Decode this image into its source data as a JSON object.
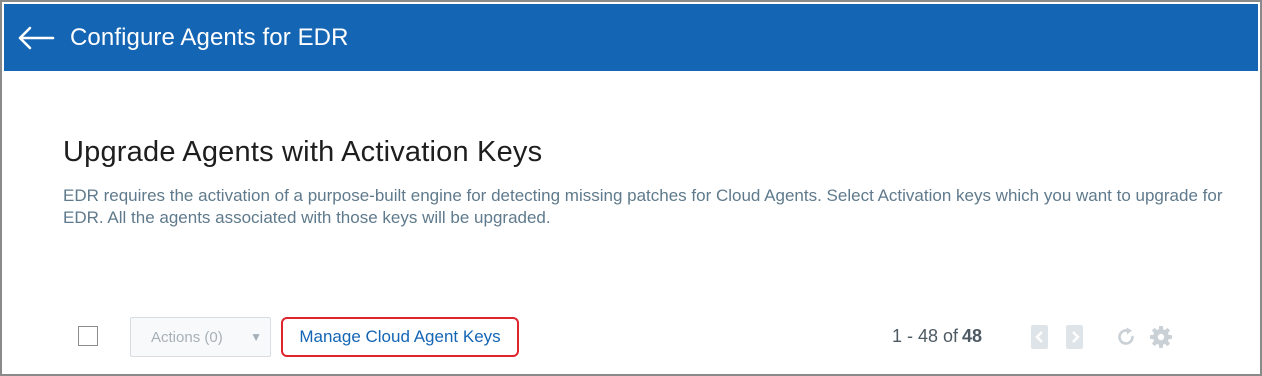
{
  "header": {
    "back_icon": "arrow-left-icon",
    "title": "Configure Agents for EDR",
    "background": "#1565b5"
  },
  "main": {
    "heading": "Upgrade Agents with Activation Keys",
    "description": "EDR requires the activation of a purpose-built engine for detecting missing patches for Cloud Agents. Select Activation keys which you want to upgrade for EDR. All the agents associated with those keys will be upgraded."
  },
  "toolbar": {
    "select_all_checked": false,
    "actions_label": "Actions (0)",
    "actions_caret": "▼",
    "manage_link": "Manage Cloud Agent Keys",
    "manage_highlight_color": "#e0242d",
    "pagination": {
      "range": "1 - 48 of",
      "total": "48",
      "prev_icon": "chevron-left-icon",
      "next_icon": "chevron-right-icon"
    },
    "refresh_icon": "refresh-icon",
    "settings_icon": "gear-icon"
  }
}
